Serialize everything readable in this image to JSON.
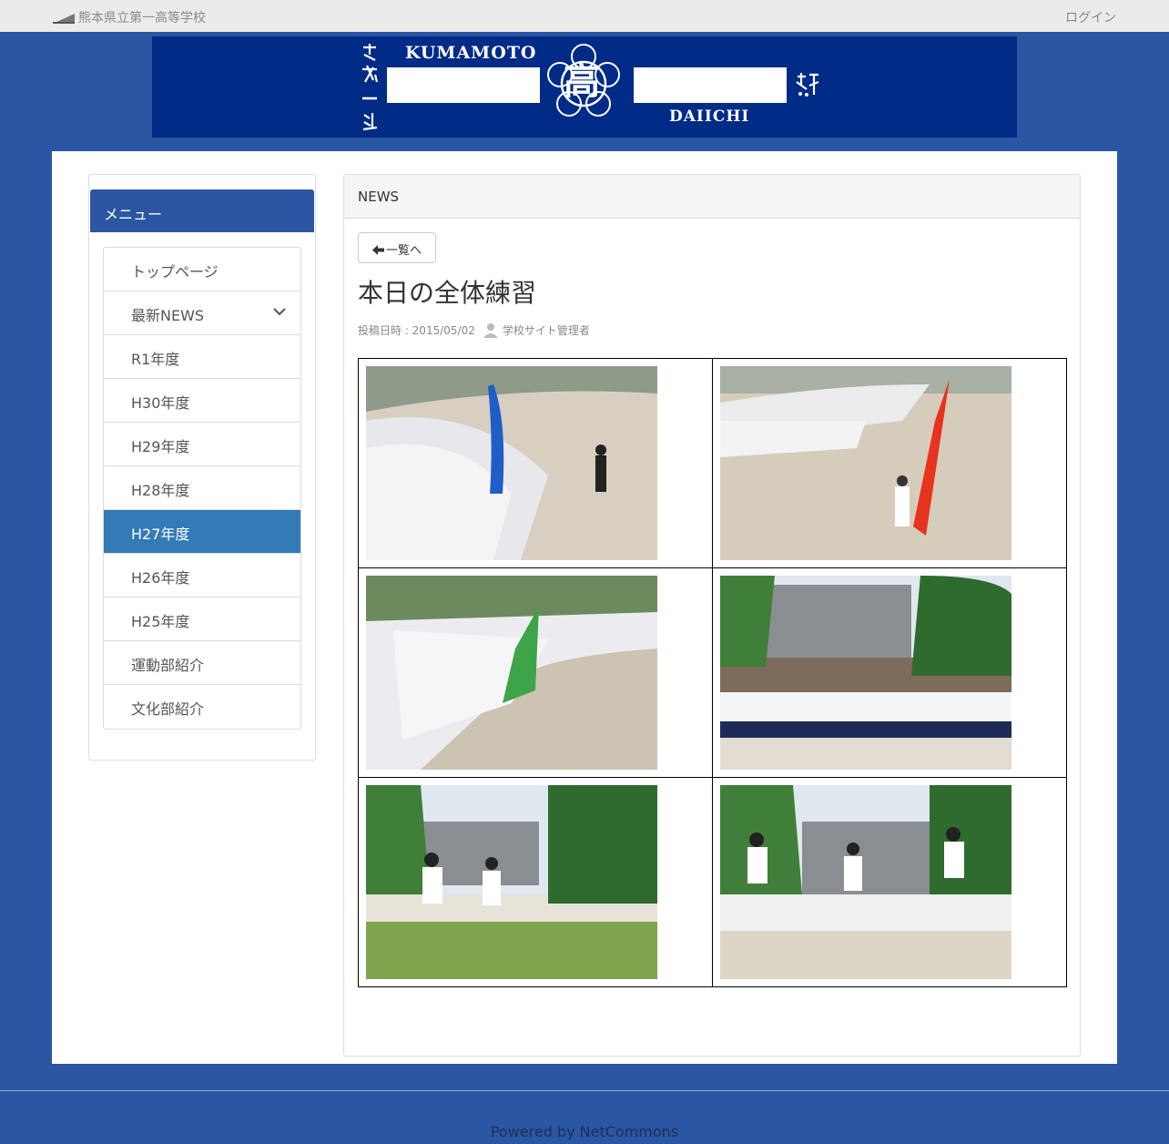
{
  "topbar": {
    "site_name": "熊本県立第一高等学校",
    "login_label": "ログイン"
  },
  "banner": {
    "line_top": "KUMAMOTO",
    "line_bottom": "DAIICHI",
    "crest_char": "高",
    "motto_icon": "calligraphy-motto",
    "colors": {
      "background": "#002b87",
      "text": "#ffffff"
    }
  },
  "sidebar": {
    "heading": "メニュー",
    "items": [
      {
        "label": "トップページ",
        "active": false
      },
      {
        "label": "最新NEWS",
        "active": false,
        "has_submenu": true
      },
      {
        "label": "R1年度",
        "active": false
      },
      {
        "label": "H30年度",
        "active": false
      },
      {
        "label": "H29年度",
        "active": false
      },
      {
        "label": "H28年度",
        "active": false
      },
      {
        "label": "H27年度",
        "active": true
      },
      {
        "label": "H26年度",
        "active": false
      },
      {
        "label": "H25年度",
        "active": false
      },
      {
        "label": "運動部紹介",
        "active": false
      },
      {
        "label": "文化部紹介",
        "active": false
      }
    ]
  },
  "panel": {
    "heading": "NEWS",
    "back_label": "一覧へ",
    "article": {
      "title": "本日の全体練習",
      "posted_label": "投稿日時 : 2015/05/02",
      "author": "学校サイト管理者"
    },
    "photos": [
      {
        "subject": "marching-blue-flag"
      },
      {
        "subject": "marching-red-flag"
      },
      {
        "subject": "marching-green-flag"
      },
      {
        "subject": "group-dance"
      },
      {
        "subject": "relay-girls"
      },
      {
        "subject": "relay-boys"
      }
    ]
  },
  "footer": {
    "powered": "Powered by NetCommons"
  },
  "colors": {
    "page_bg": "#2b56a3",
    "active_item": "#337ab7",
    "topbar_bg": "#ebebeb"
  }
}
